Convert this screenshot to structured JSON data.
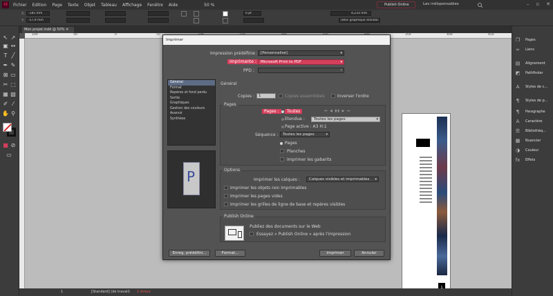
{
  "app": {
    "logo": "Id"
  },
  "menubar": {
    "items": [
      "Fichier",
      "Edition",
      "Page",
      "Texte",
      "Objet",
      "Tableau",
      "Affichage",
      "Fenêtre",
      "Aide"
    ],
    "zoom": "50 %",
    "publish_label": "Publish Online",
    "workspace": "Les indispensables"
  },
  "controlbar": {
    "x": "-185 mm",
    "y": "-57,9 mm",
    "w_value": "0 pt",
    "size_value": "4,233 mm",
    "style_value": "[Bloc graphique standar..."
  },
  "document": {
    "tab_title": "Mon projet.indd @ 50%"
  },
  "ruler": {
    "top_numbers": [
      "100",
      "50",
      "0",
      "50",
      "100",
      "150",
      "200",
      "250",
      "300",
      "350",
      "400",
      "450"
    ]
  },
  "panels": {
    "items": [
      {
        "label": "Pages",
        "icon": "pages-icon"
      },
      {
        "label": "Liens",
        "icon": "links-icon"
      },
      {
        "label": "Alignement",
        "icon": "align-icon"
      },
      {
        "label": "Pathfinder",
        "icon": "pathfinder-icon"
      },
      {
        "label": "Styles de c...",
        "icon": "char-styles-icon"
      },
      {
        "label": "Styles de p...",
        "icon": "para-styles-icon"
      },
      {
        "label": "Paragraphe",
        "icon": "paragraph-icon"
      },
      {
        "label": "Caractère",
        "icon": "character-icon"
      },
      {
        "label": "Bibliothèq...",
        "icon": "library-icon"
      },
      {
        "label": "Nuancier",
        "icon": "swatches-icon"
      },
      {
        "label": "Couleur",
        "icon": "color-icon"
      },
      {
        "label": "Effets",
        "icon": "effects-icon"
      }
    ]
  },
  "dialog": {
    "title": "Imprimer",
    "preset_label": "Impression prédéfinie :",
    "preset_value": "[Personnalisé]",
    "printer_label": "Imprimante :",
    "printer_value": "Microsoft Print to PDF",
    "ppd_label": "PPD :",
    "ppd_value": "",
    "categories": [
      "Général",
      "Format",
      "Repères et fond perdu",
      "Sortie",
      "Graphiques",
      "Gestion des couleurs",
      "Avancé",
      "Synthèse"
    ],
    "selected_category": "Général",
    "section_title": "Général",
    "copies_label": "Copies :",
    "copies_value": "1",
    "collate_label": "Copies assemblées",
    "reverse_label": "Inverser l'ordre",
    "pages_group": "Pages",
    "pages_label": "Pages :",
    "pages_value": "Toutes",
    "range_label": "Etendue :",
    "range_value": "Toutes les pages",
    "active_page": "Page active : A3 H:1",
    "sequence_label": "Séquence :",
    "sequence_value": "Toutes les pages",
    "opt_pages": "Pages",
    "opt_spreads": "Planches",
    "opt_masters": "Imprimer les gabarits",
    "options_group": "Options",
    "layers_label": "Imprimer les calques :",
    "layers_value": "Calques visibles et imprimables",
    "opt_nonprint": "Imprimer les objets non imprimables",
    "opt_blank": "Imprimer les pages vides",
    "opt_grids": "Imprimer les grilles de ligne de base et repères visibles",
    "publish_group": "Publish Online",
    "publish_text": "Publiez des documents sur le Web",
    "publish_check": "Essayez « Publish Online » après l'impression",
    "btn_save_preset": "Enreg. prédéfini...",
    "btn_setup": "Format...",
    "btn_print": "Imprimer",
    "btn_cancel": "Annuler"
  },
  "statusbar": {
    "page": "1",
    "style": "[Standard] (de travail)",
    "errors": "1 erreur"
  }
}
